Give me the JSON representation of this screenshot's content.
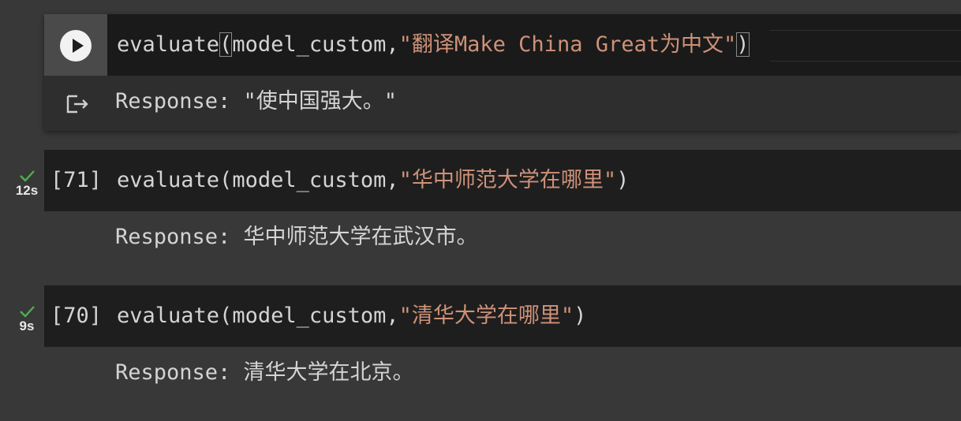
{
  "cells": [
    {
      "code": {
        "func": "evaluate(",
        "open_paren": "(",
        "func_name": "evaluate",
        "arg": "model_custom,",
        "string": "\"翻译Make China Great为中文\"",
        "close_paren": ")"
      },
      "output": "Response: \"使中国强大。\""
    },
    {
      "exec_count": "[71]",
      "duration": "12s",
      "code": {
        "func_name": "evaluate",
        "open_paren": "(",
        "arg": "model_custom,",
        "string": "\"华中师范大学在哪里\"",
        "close_paren": ")"
      },
      "output": "Response: 华中师范大学在武汉市。"
    },
    {
      "exec_count": "[70]",
      "duration": "9s",
      "code": {
        "func_name": "evaluate",
        "open_paren": "(",
        "arg": "model_custom,",
        "string": "\"清华大学在哪里\"",
        "close_paren": ")"
      },
      "output": "Response: 清华大学在北京。"
    }
  ],
  "colors": {
    "background": "#383838",
    "code_bg": "#1e1e1e",
    "string": "#ce9178",
    "text": "#d4d4d4",
    "check": "#4caf50"
  },
  "icons": {
    "run": "play-icon",
    "output": "output-redirect-icon",
    "status": "check-icon"
  }
}
